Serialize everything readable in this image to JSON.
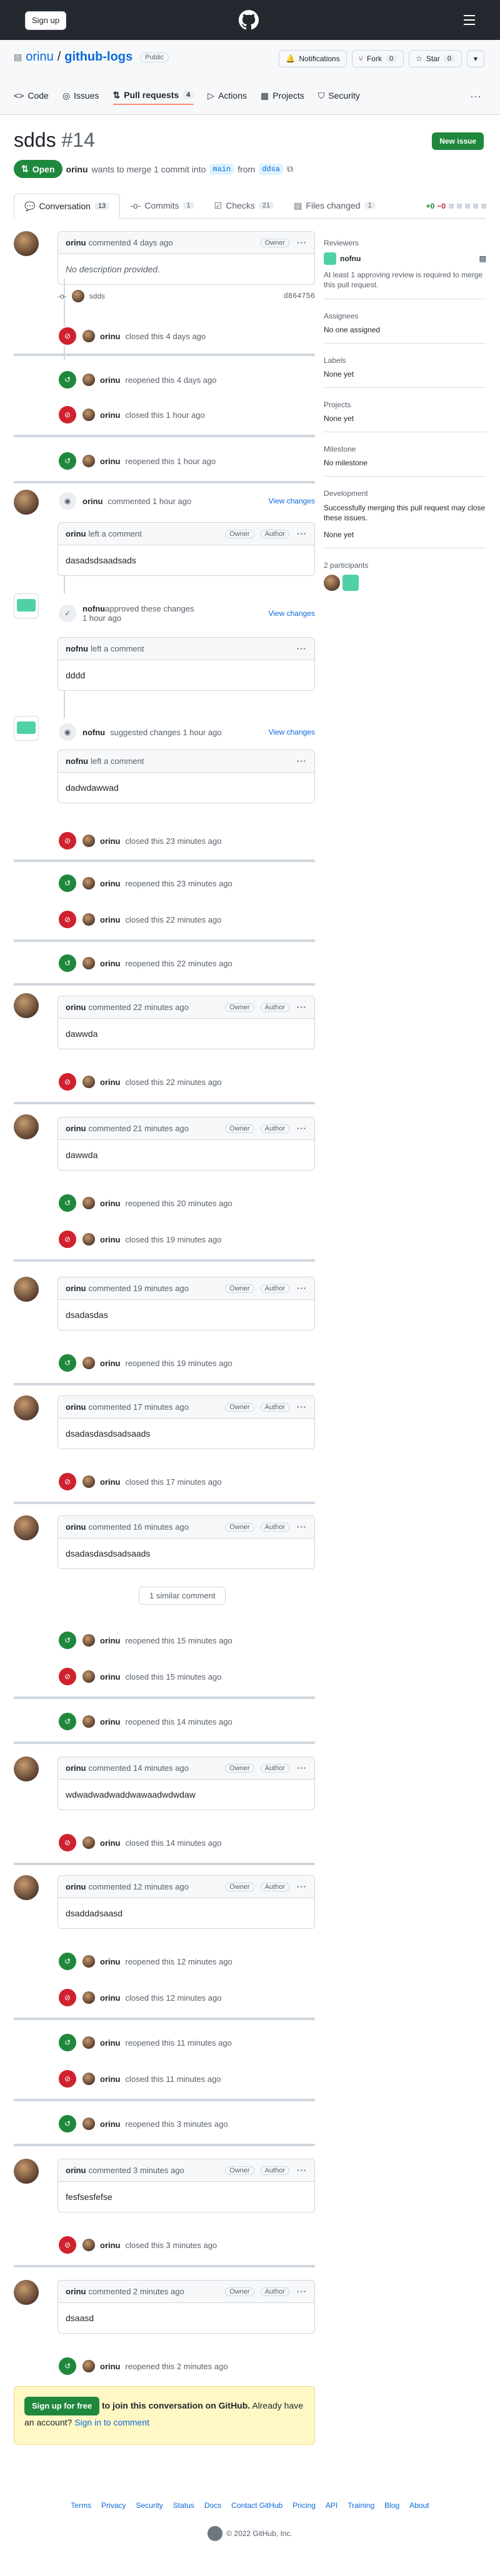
{
  "header": {
    "signup_label": "Sign up"
  },
  "repo": {
    "owner": "orinu",
    "name": "github-logs",
    "visibility": "Public",
    "notifications": "Notifications",
    "fork": "Fork",
    "fork_count": "0",
    "star": "Star",
    "star_count": "0"
  },
  "repo_tabs": [
    {
      "label": "Code"
    },
    {
      "label": "Issues"
    },
    {
      "label": "Pull requests",
      "count": "4"
    },
    {
      "label": "Actions"
    },
    {
      "label": "Projects"
    },
    {
      "label": "Security"
    }
  ],
  "pr": {
    "title": "sdds",
    "number": "#14",
    "new_issue": "New issue",
    "state": "Open",
    "author": "orinu",
    "merge_text": "wants to merge 1 commit into",
    "base": "main",
    "from": "from",
    "head": "ddsa"
  },
  "pr_tabs": [
    {
      "label": "Conversation",
      "count": "13"
    },
    {
      "label": "Commits",
      "count": "1"
    },
    {
      "label": "Checks",
      "count": "21"
    },
    {
      "label": "Files changed",
      "count": "1"
    }
  ],
  "diffstat": {
    "add": "+0",
    "del": "−0"
  },
  "sidebar": {
    "reviewers_h": "Reviewers",
    "reviewer": "nofnu",
    "reviewer_note": "At least 1 approving review is required to merge this pull request.",
    "assignees_h": "Assignees",
    "assignees": "No one assigned",
    "labels_h": "Labels",
    "labels": "None yet",
    "projects_h": "Projects",
    "projects": "None yet",
    "milestone_h": "Milestone",
    "milestone": "No milestone",
    "development_h": "Development",
    "development": "Successfully merging this pull request may close these issues.",
    "development2": "None yet",
    "participants_h": "2 participants"
  },
  "labels": {
    "owner": "Owner",
    "author": "Author",
    "view_changes": "View changes",
    "left_comment": "left a comment",
    "approved": "approved these changes",
    "suggested": "suggested changes",
    "similar": "1 similar comment"
  },
  "first": {
    "user": "orinu",
    "meta": "commented 4 days ago",
    "body": "No description provided.",
    "commit_msg": "sdds",
    "sha": "d864756"
  },
  "events": [
    {
      "user": "orinu",
      "text": "closed this 4 days ago"
    },
    {
      "user": "orinu",
      "text": "reopened this 4 days ago"
    },
    {
      "user": "orinu",
      "text": "closed this 1 hour ago"
    },
    {
      "user": "orinu",
      "text": "reopened this 1 hour ago"
    },
    {
      "user": "orinu",
      "text": "commented 1 hour ago"
    },
    {
      "user": "orinu",
      "text": "closed this 23 minutes ago"
    },
    {
      "user": "orinu",
      "text": "reopened this 23 minutes ago"
    },
    {
      "user": "orinu",
      "text": "closed this 22 minutes ago"
    },
    {
      "user": "orinu",
      "text": "reopened this 22 minutes ago"
    },
    {
      "user": "orinu",
      "text": "closed this 22 minutes ago"
    },
    {
      "user": "orinu",
      "text": "reopened this 20 minutes ago"
    },
    {
      "user": "orinu",
      "text": "closed this 19 minutes ago"
    },
    {
      "user": "orinu",
      "text": "reopened this 19 minutes ago"
    },
    {
      "user": "orinu",
      "text": "closed this 17 minutes ago"
    },
    {
      "user": "orinu",
      "text": "reopened this 15 minutes ago"
    },
    {
      "user": "orinu",
      "text": "closed this 15 minutes ago"
    },
    {
      "user": "orinu",
      "text": "reopened this 14 minutes ago"
    },
    {
      "user": "orinu",
      "text": "closed this 14 minutes ago"
    },
    {
      "user": "orinu",
      "text": "reopened this 12 minutes ago"
    },
    {
      "user": "orinu",
      "text": "closed this 12 minutes ago"
    },
    {
      "user": "orinu",
      "text": "reopened this 11 minutes ago"
    },
    {
      "user": "orinu",
      "text": "closed this 11 minutes ago"
    },
    {
      "user": "orinu",
      "text": "reopened this 3 minutes ago"
    },
    {
      "user": "orinu",
      "text": "closed this 3 minutes ago"
    },
    {
      "user": "orinu",
      "text": "reopened this 2 minutes ago"
    }
  ],
  "comments": [
    {
      "user": "orinu",
      "meta": "left a comment",
      "body": "dasadsdsaadsads"
    },
    {
      "user": "nofnu",
      "meta": "approved these changes",
      "time": "1 hour ago"
    },
    {
      "user": "nofnu",
      "meta": "left a comment",
      "body": "dddd"
    },
    {
      "user": "nofnu",
      "meta": "suggested changes 1 hour ago"
    },
    {
      "user": "nofnu",
      "meta": "left a comment",
      "body": "dadwdawwad"
    },
    {
      "user": "orinu",
      "meta": "commented 22 minutes ago",
      "body": "dawwda"
    },
    {
      "user": "orinu",
      "meta": "commented 21 minutes ago",
      "body": "dawwda"
    },
    {
      "user": "orinu",
      "meta": "commented 19 minutes ago",
      "body": "dsadasdas"
    },
    {
      "user": "orinu",
      "meta": "commented 17 minutes ago",
      "body": "dsadasdasdsadsaads"
    },
    {
      "user": "orinu",
      "meta": "commented 16 minutes ago",
      "body": "dsadasdasdsadsaads"
    },
    {
      "user": "orinu",
      "meta": "commented 14 minutes ago",
      "body": "wdwadwadwaddwawaadwdwdaw"
    },
    {
      "user": "orinu",
      "meta": "commented 12 minutes ago",
      "body": "dsaddadsaasd"
    },
    {
      "user": "orinu",
      "meta": "commented 3 minutes ago",
      "body": "fesfsesfefse"
    },
    {
      "user": "orinu",
      "meta": "commented 2 minutes ago",
      "body": "dsaasd"
    }
  ],
  "cta": {
    "button": "Sign up for free",
    "text": "to join this conversation on GitHub.",
    "text2": "Already have an account?",
    "signin": "Sign in to comment"
  },
  "footer": {
    "links": [
      "Terms",
      "Privacy",
      "Security",
      "Status",
      "Docs",
      "Contact GitHub",
      "Pricing",
      "API",
      "Training",
      "Blog",
      "About"
    ],
    "copy": "© 2022 GitHub, Inc."
  }
}
